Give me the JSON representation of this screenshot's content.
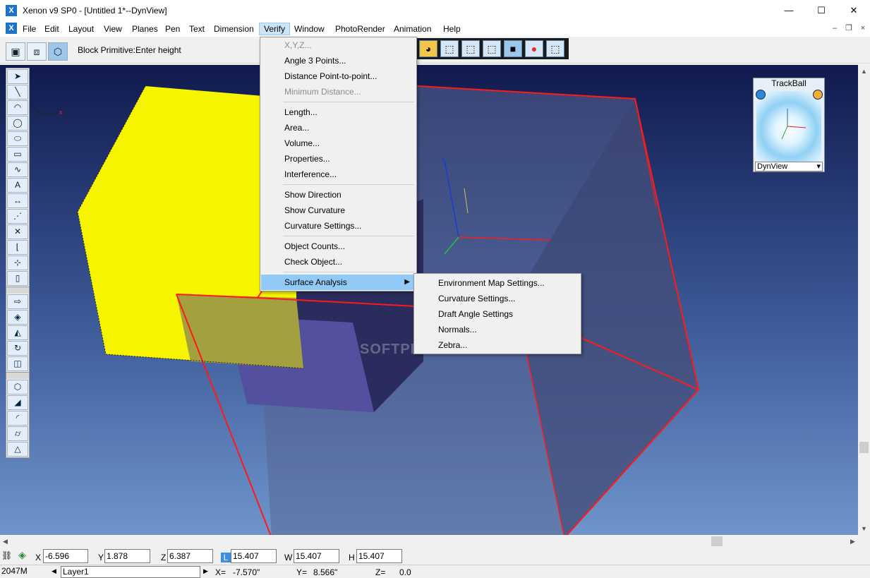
{
  "window": {
    "title": "Xenon v9 SP0 - [Untitled 1*--DynView]",
    "app_icon_glyph": "X",
    "minimize_glyph": "—",
    "maximize_glyph": "☐",
    "close_glyph": "✕"
  },
  "menubar": {
    "icon_glyph": "X",
    "items": [
      "File",
      "Edit",
      "Layout",
      "View",
      "Planes",
      "Pen",
      "Text",
      "Dimension",
      "Verify",
      "Window",
      "PhotoRender",
      "Animation",
      "Help"
    ],
    "mdi_minimize": "–",
    "mdi_restore": "❐",
    "mdi_close": "×"
  },
  "toolbar": {
    "prompt": "Block Primitive:Enter height"
  },
  "verify_menu": {
    "items": [
      {
        "label": "X,Y,Z...",
        "disabled": true
      },
      {
        "label": "Angle 3 Points..."
      },
      {
        "label": "Distance Point-to-point..."
      },
      {
        "label": "Minimum Distance...",
        "disabled": true
      },
      {
        "label": "Length..."
      },
      {
        "label": "Area..."
      },
      {
        "label": "Volume..."
      },
      {
        "label": "Properties..."
      },
      {
        "label": "Interference..."
      },
      {
        "label": "Show Direction"
      },
      {
        "label": "Show Curvature"
      },
      {
        "label": "Curvature Settings..."
      },
      {
        "label": "Object Counts..."
      },
      {
        "label": "Check Object..."
      },
      {
        "label": "Surface Analysis",
        "highlighted": true,
        "submenu": true
      }
    ],
    "submenu_arrow": "▶"
  },
  "surface_analysis_submenu": {
    "items": [
      "Environment Map Settings...",
      "Curvature Settings...",
      "Draft Angle Settings",
      "Normals...",
      "Zebra..."
    ]
  },
  "trackball": {
    "title": "TrackBall",
    "view_select": "DynView",
    "select_arrow": "▾"
  },
  "viewport": {
    "axis_x": "x",
    "axis_y": "y",
    "axis_x_small": "x",
    "watermark": "SOFTPEDIA"
  },
  "coords": {
    "x_label": "X",
    "x_value": "-6.596",
    "y_label": "Y",
    "y_value": "1.878",
    "z_label": "Z",
    "z_value": "6.387",
    "l_label": "L",
    "l_value": "15.407",
    "w_label": "W",
    "w_value": "15.407",
    "h_label": "H",
    "h_value": "15.407"
  },
  "status": {
    "memory": "2047M 2047M",
    "layer": "Layer1",
    "x_label": "X=",
    "x_value": "-7.570\"",
    "y_label": "Y=",
    "y_value": "8.566\"",
    "z_label": "Z=",
    "z_value": "0.0"
  },
  "colors": {
    "menu_highlight": "#91c9f7",
    "active_menu": "#cce4f7",
    "yellow_cube": "#f7f400",
    "edge_red": "#ff1a1a",
    "viewport_top": "#101a4e",
    "viewport_bottom": "#6f95cc"
  },
  "left_palette_icons": [
    "select-arrow-icon",
    "line-icon",
    "arc-3pt-icon",
    "circle-icon",
    "ellipse-icon",
    "rectangle-icon",
    "spline-icon",
    "text-icon",
    "dimension-icon",
    "point-icon",
    "trim-icon",
    "chamfer-icon",
    "move-icon",
    "scale-icon",
    "extrude-icon",
    "sweep-icon",
    "loft-icon",
    "revolve-icon",
    "shell-icon",
    "box-icon",
    "wedge-icon",
    "fillet-icon",
    "cylinder-icon",
    "cone-icon"
  ]
}
